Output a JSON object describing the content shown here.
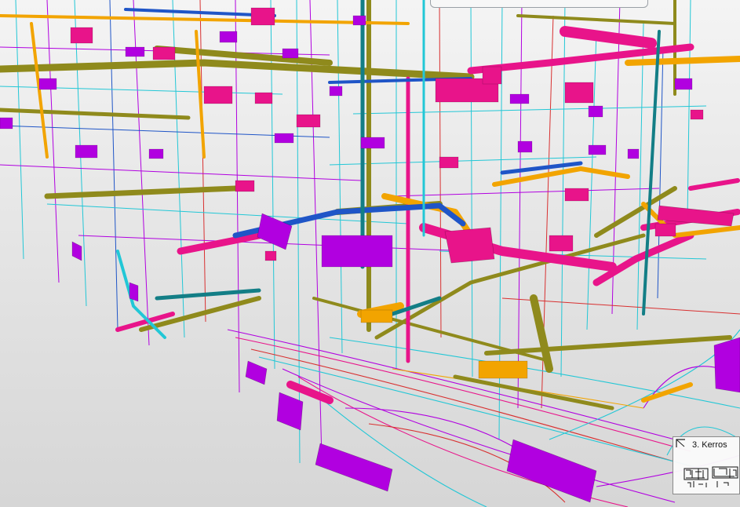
{
  "app": {
    "view": "3d-model-viewport"
  },
  "floor_selector": {
    "label": "3. Kerros",
    "marker_icon": "floor-marker-icon",
    "thumbnail_icon": "floor-plan-thumbnail"
  },
  "colors": {
    "pipe_olive": "#8f8a1c",
    "pipe_magenta": "#e8148a",
    "pipe_orange": "#f2a400",
    "pipe_blue": "#1f55c7",
    "pipe_cyan": "#22c7d6",
    "duct_purple": "#b100e0",
    "pipe_teal": "#137e86",
    "wire_red": "#d83030",
    "background": "#e6e6e6"
  }
}
